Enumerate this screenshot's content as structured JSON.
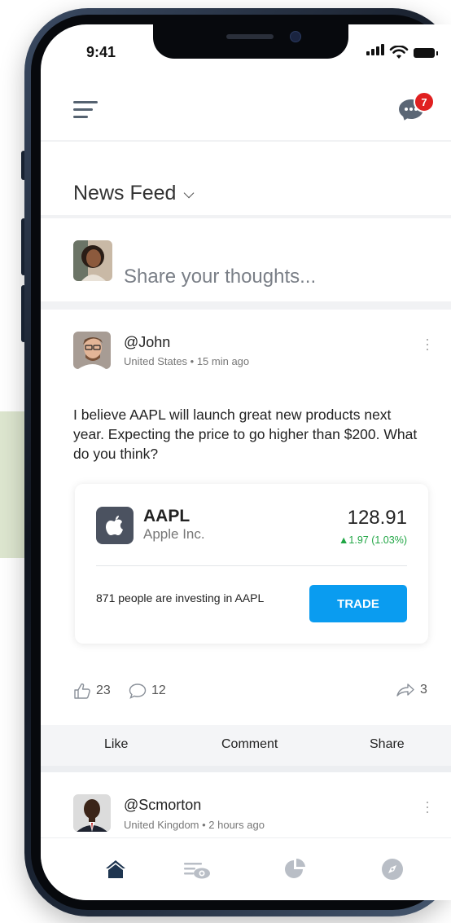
{
  "status_bar": {
    "time": "9:41"
  },
  "header": {
    "notification_count": "7"
  },
  "feed": {
    "title": "News Feed"
  },
  "composer": {
    "placeholder": "Share your thoughts..."
  },
  "posts": [
    {
      "username": "@John",
      "meta": "United States • 15 min ago",
      "text": "I believe AAPL will launch great new products next year. Expecting the price to go higher than $200. What do you think?",
      "stock": {
        "ticker": "AAPL",
        "company": "Apple Inc.",
        "price": "128.91",
        "change": "▲1.97 (1.03%)",
        "investing_text": "871 people are investing in AAPL",
        "trade_label": "TRADE"
      },
      "likes": "23",
      "comments": "12",
      "shares": "3"
    },
    {
      "username": "@Scmorton",
      "meta": "United Kingdom • 2 hours ago"
    }
  ],
  "actions": {
    "like": "Like",
    "comment": "Comment",
    "share": "Share"
  },
  "colors": {
    "accent": "#0a9cf0",
    "positive": "#21a645",
    "badge": "#e02020",
    "tab_active": "#1e3550",
    "tab_inactive": "#b9bec6"
  }
}
